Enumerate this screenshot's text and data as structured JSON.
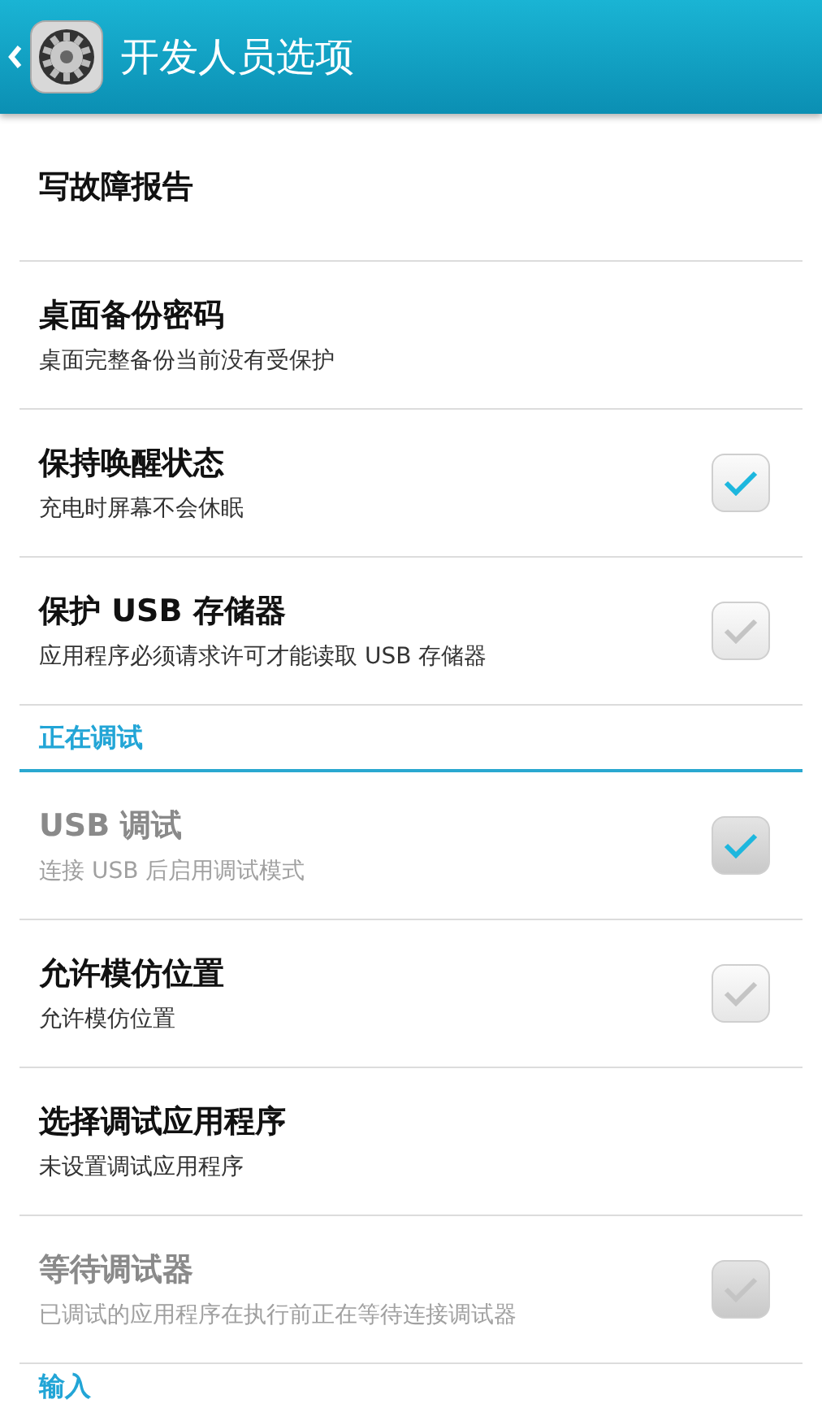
{
  "header": {
    "title": "开发人员选项"
  },
  "sections": [
    {
      "items": [
        {
          "kind": "plain",
          "title": "写故障报告",
          "disabled": false
        },
        {
          "kind": "plain",
          "title": "桌面备份密码",
          "summary": "桌面完整备份当前没有受保护",
          "disabled": false
        },
        {
          "kind": "checkbox",
          "title": "保持唤醒状态",
          "summary": "充电时屏幕不会休眠",
          "disabled": false,
          "checked": true
        },
        {
          "kind": "checkbox",
          "title": "保护 USB 存储器",
          "summary": "应用程序必须请求许可才能读取 USB 存储器",
          "disabled": false,
          "checked": false
        }
      ]
    },
    {
      "heading": "正在调试",
      "items": [
        {
          "kind": "checkbox",
          "title": "USB 调试",
          "summary": "连接 USB 后启用调试模式",
          "disabled": true,
          "checked": true
        },
        {
          "kind": "checkbox",
          "title": "允许模仿位置",
          "summary": "允许模仿位置",
          "disabled": false,
          "checked": false
        },
        {
          "kind": "plain",
          "title": "选择调试应用程序",
          "summary": "未设置调试应用程序",
          "disabled": false
        },
        {
          "kind": "checkbox",
          "title": "等待调试器",
          "summary": "已调试的应用程序在执行前正在等待连接调试器",
          "disabled": true,
          "checked": false
        }
      ]
    },
    {
      "heading": "输入"
    }
  ]
}
